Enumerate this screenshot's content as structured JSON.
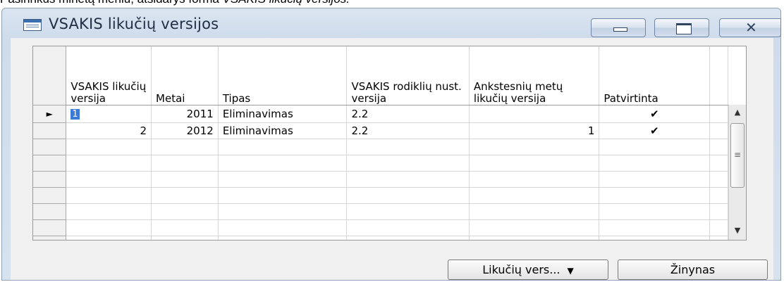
{
  "caption": {
    "prefix": "Pasirinkus minėtą meniu, atsidarys forma ",
    "emphasis": "VSAKIS likučių versijos."
  },
  "window": {
    "title": "VSAKIS likučių versijos",
    "icon": "form-icon",
    "controls": [
      "minimize-icon",
      "maximize-icon",
      "close-icon"
    ]
  },
  "grid": {
    "columns": [
      "VSAKIS likučių versija",
      "Metai",
      "Tipas",
      "VSAKIS rodiklių nust. versija",
      "Ankstesnių metų likučių versija",
      "Patvirtinta"
    ],
    "rows": [
      {
        "indicator": "►",
        "version": "1",
        "year": "2011",
        "type": "Eliminavimas",
        "indicator_version": "2.2",
        "prev_version": "",
        "approved": "✔"
      },
      {
        "indicator": "",
        "version": "2",
        "year": "2012",
        "type": "Eliminavimas",
        "indicator_version": "2.2",
        "prev_version": "1",
        "approved": "✔"
      }
    ]
  },
  "buttons": {
    "versions": "Likučių vers...",
    "reference": "Žinynas"
  }
}
